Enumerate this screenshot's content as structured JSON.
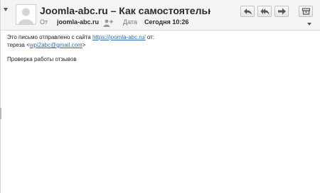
{
  "message": {
    "subject": "Joomla-abc.ru – Как самостоятельно со...",
    "from_label": "От",
    "from_value": "joomla-abc.ru",
    "date_label": "Дата",
    "date_value": "Сегодня 10:26"
  },
  "toolbar": {
    "reply_icon": "reply-icon",
    "reply_all_icon": "reply-all-icon",
    "forward_icon": "forward-icon",
    "archive_icon": "archive-icon"
  },
  "body": {
    "line1_prefix": "Это письмо отправлено с сайта ",
    "site_link": "https://joomla-abc.ru/",
    "line1_suffix": " от:",
    "line2_prefix": "тереза <",
    "email_link": "wpi2abc@gmail.com",
    "line2_suffix": ">",
    "text": "Проверка работы отзывов"
  }
}
